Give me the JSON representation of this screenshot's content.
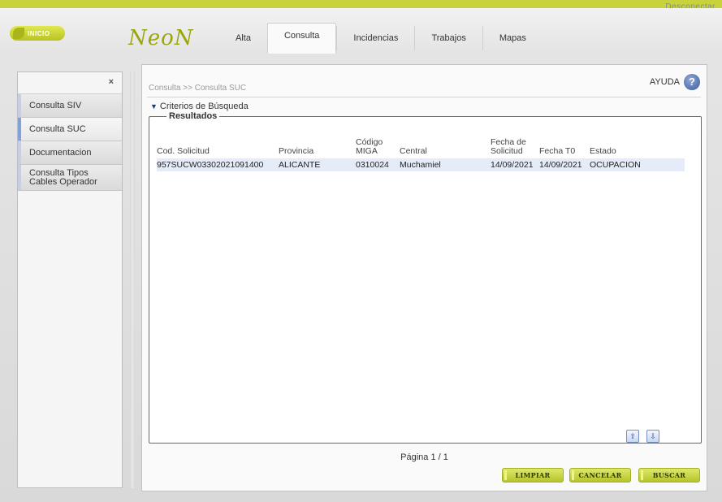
{
  "header": {
    "disconnect_label": "Desconectar",
    "home_label": "INICIO",
    "logo_text": "NeoN",
    "tabs": [
      {
        "label": "Alta"
      },
      {
        "label": "Consulta"
      },
      {
        "label": "Incidencias"
      },
      {
        "label": "Trabajos"
      },
      {
        "label": "Mapas"
      }
    ]
  },
  "sidebar": {
    "close_label": "×",
    "items": [
      {
        "label": "Consulta SIV"
      },
      {
        "label": "Consulta SUC"
      },
      {
        "label": "Documentacion"
      },
      {
        "label": "Consulta Tipos Cables Operador"
      }
    ]
  },
  "main": {
    "breadcrumb": "Consulta >> Consulta SUC",
    "help_label": "AYUDA",
    "criteria_label": "Criterios de Búsqueda",
    "results_title": "Resultados",
    "columns": [
      "Cod. Solicitud",
      "Provincia",
      "Código MIGA",
      "Central",
      "Fecha de Solicitud",
      "Fecha T0",
      "Estado"
    ],
    "rows": [
      [
        "957SUCW03302021091400",
        "ALICANTE",
        "0310024",
        "Muchamiel",
        "14/09/2021",
        "14/09/2021",
        "OCUPACION"
      ]
    ],
    "pagination": "Página  1 / 1",
    "buttons": {
      "clear": "LIMPIAR",
      "cancel": "CANCELAR",
      "search": "BUSCAR"
    }
  },
  "colors": {
    "brand_green": "#c8d23a",
    "panel_border": "#5a6790",
    "row_highlight": "#e6ecf7"
  }
}
